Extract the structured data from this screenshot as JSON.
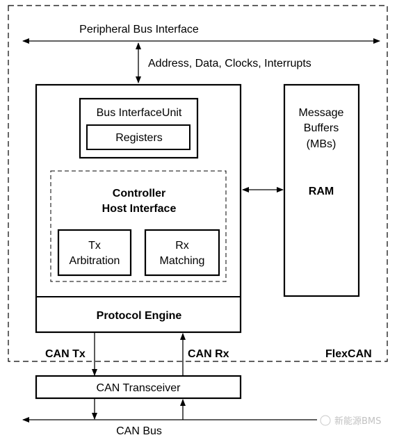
{
  "labels": {
    "peripheral_bus": "Peripheral Bus Interface",
    "address_data": "Address, Data, Clocks, Interrupts",
    "bus_interface_unit": "Bus InterfaceUnit",
    "registers": "Registers",
    "controller_line1": "Controller",
    "controller_line2": "Host Interface",
    "tx_line1": "Tx",
    "tx_line2": "Arbitration",
    "rx_line1": "Rx",
    "rx_line2": "Matching",
    "protocol_engine": "Protocol Engine",
    "mb_line1": "Message",
    "mb_line2": "Buffers",
    "mb_line3": "(MBs)",
    "ram": "RAM",
    "can_tx": "CAN Tx",
    "can_rx": "CAN Rx",
    "flexcan": "FlexCAN",
    "can_transceiver": "CAN Transceiver",
    "can_bus": "CAN Bus"
  },
  "watermark": "新能源BMS"
}
